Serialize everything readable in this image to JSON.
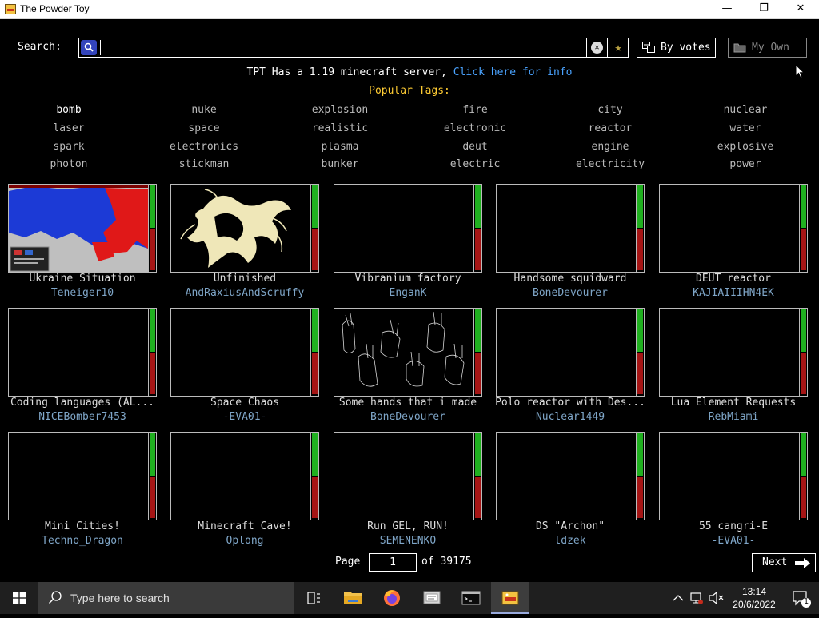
{
  "window": {
    "title": "The Powder Toy"
  },
  "search": {
    "label": "Search:",
    "value": "",
    "placeholder": ""
  },
  "sort": {
    "by_votes_label": "By votes",
    "my_own_label": "My Own"
  },
  "notice": {
    "text": "TPT Has a 1.19 minecraft server,",
    "link": "Click here for info"
  },
  "popular_tags": {
    "heading": "Popular Tags:",
    "rows": [
      [
        "bomb",
        "nuke",
        "explosion",
        "fire",
        "city",
        "nuclear"
      ],
      [
        "laser",
        "space",
        "realistic",
        "electronic",
        "reactor",
        "water"
      ],
      [
        "spark",
        "electronics",
        "plasma",
        "deut",
        "engine",
        "explosive"
      ],
      [
        "photon",
        "stickman",
        "bunker",
        "electric",
        "electricity",
        "power"
      ]
    ]
  },
  "saves": [
    {
      "name": "Ukraine Situation",
      "author": "Teneiger10"
    },
    {
      "name": "Unfinished",
      "author": "AndRaxiusAndScruffy"
    },
    {
      "name": "Vibranium factory",
      "author": "EnganK"
    },
    {
      "name": "Handsome squidward",
      "author": "BoneDevourer"
    },
    {
      "name": "DEUT reactor",
      "author": "KAJIAIIIHN4EK"
    },
    {
      "name": "Coding languages (AL...",
      "author": "NICEBomber7453"
    },
    {
      "name": "Space Chaos",
      "author": "-EVA01-"
    },
    {
      "name": "Some hands that i made",
      "author": "BoneDevourer"
    },
    {
      "name": "Polo reactor with Des...",
      "author": "Nuclear1449"
    },
    {
      "name": "Lua Element Requests",
      "author": "RebMiami"
    },
    {
      "name": "Mini Cities!",
      "author": "Techno_Dragon"
    },
    {
      "name": "Minecraft Cave!",
      "author": "Oplong"
    },
    {
      "name": "Run GEL, RUN!",
      "author": "SEMENENKO"
    },
    {
      "name": "DS \"Archon\"",
      "author": "ldzek"
    },
    {
      "name": "55 cangri-E",
      "author": "-EVA01-"
    }
  ],
  "pagination": {
    "page_label": "Page",
    "current_page": "1",
    "of_label": "of 39175",
    "next_label": "Next"
  },
  "taskbar": {
    "search_placeholder": "Type here to search",
    "time": "13:14",
    "date": "20/6/2022",
    "notification_count": "1"
  },
  "colors": {
    "vote_up": "#20b020",
    "vote_down": "#a51515",
    "link": "#4aa3ff",
    "tags_heading": "#ffcc33",
    "author": "#7fa6c8"
  }
}
